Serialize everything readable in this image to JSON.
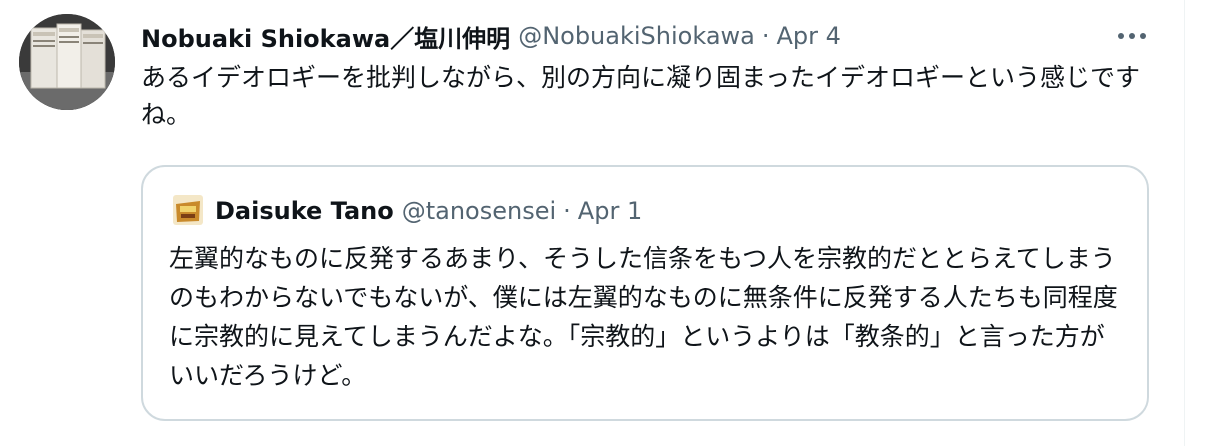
{
  "tweet": {
    "author": {
      "display_name": "Nobuaki Shiokawa／塩川伸明",
      "handle": "@NobuakiShiokawa"
    },
    "separator": "·",
    "date": "Apr 4",
    "text": "あるイデオロギーを批判しながら、別の方向に凝り固まったイデオロギーという感じですね。",
    "more_icon": "more-horizontal-icon",
    "quoted": {
      "author": {
        "display_name": "Daisuke Tano",
        "handle": "@tanosensei"
      },
      "separator": "·",
      "date": "Apr 1",
      "text": "左翼的なものに反発するあまり、そうした信条をもつ人を宗教的だととらえてしまうのもわからないでもないが、僕には左翼的なものに無条件に反発する人たちも同程度に宗教的に見えてしまうんだよな。「宗教的」というよりは「教条的」と言った方がいいだろうけど。"
    }
  },
  "colors": {
    "text_primary": "#0f1419",
    "text_secondary": "#536471",
    "border": "#cfd9de"
  }
}
